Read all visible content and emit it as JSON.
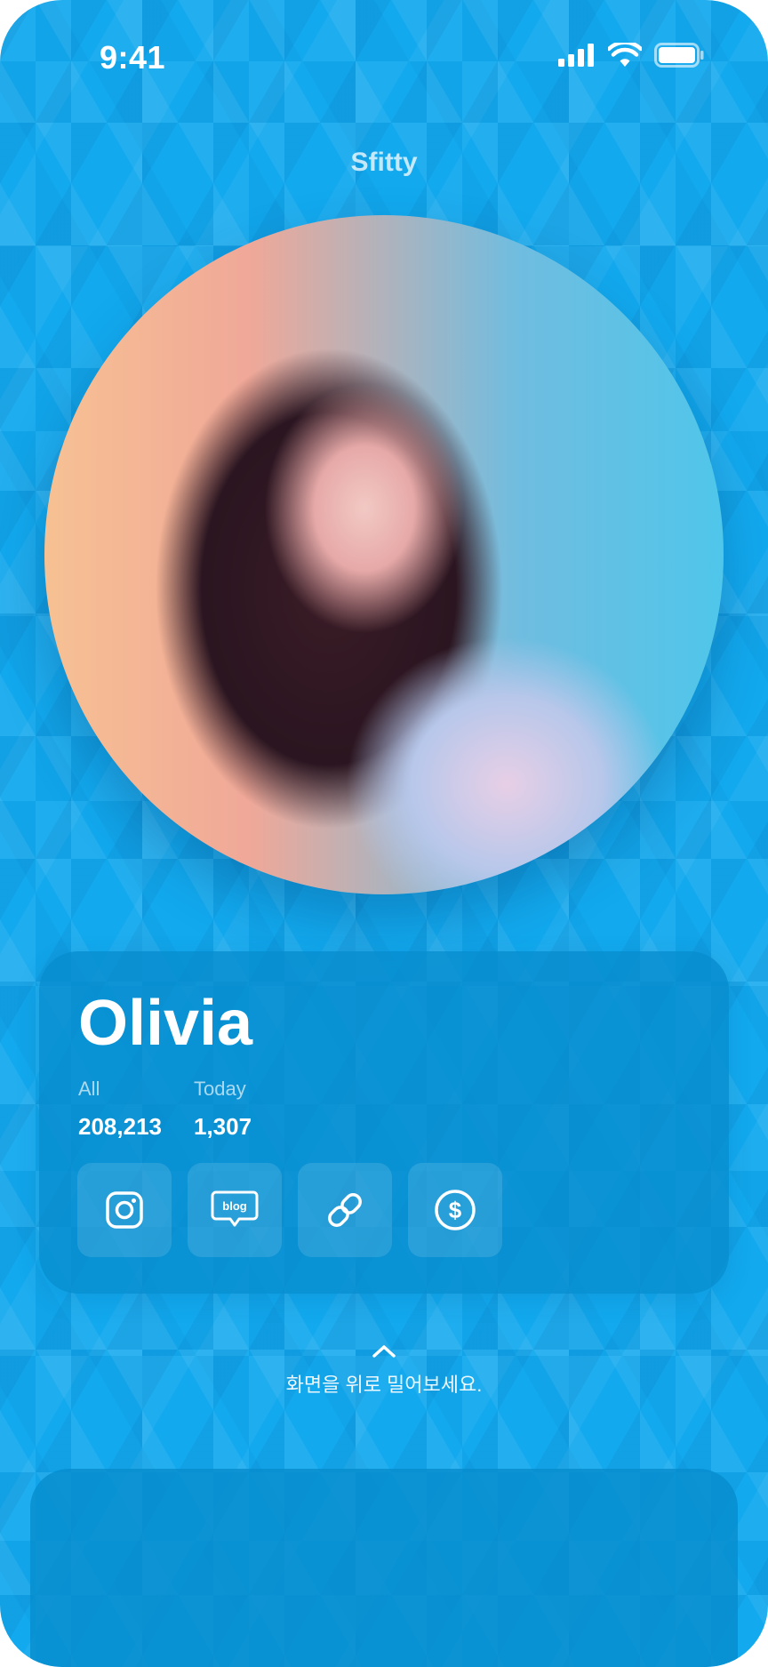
{
  "status_bar": {
    "time": "9:41"
  },
  "brand": {
    "logo_text": "Sfitty"
  },
  "profile": {
    "name": "Olivia",
    "stats": [
      {
        "label": "All",
        "value": "208,213"
      },
      {
        "label": "Today",
        "value": "1,307"
      }
    ],
    "links": [
      {
        "icon": "instagram-icon"
      },
      {
        "icon": "blog-icon",
        "text": "blog"
      },
      {
        "icon": "link-icon"
      },
      {
        "icon": "dollar-icon"
      }
    ]
  },
  "swipe_hint": {
    "text": "화면을 위로 밀어보세요."
  },
  "colors": {
    "background": "#12a9ee",
    "card": "#068ccd",
    "text": "#ffffff"
  }
}
